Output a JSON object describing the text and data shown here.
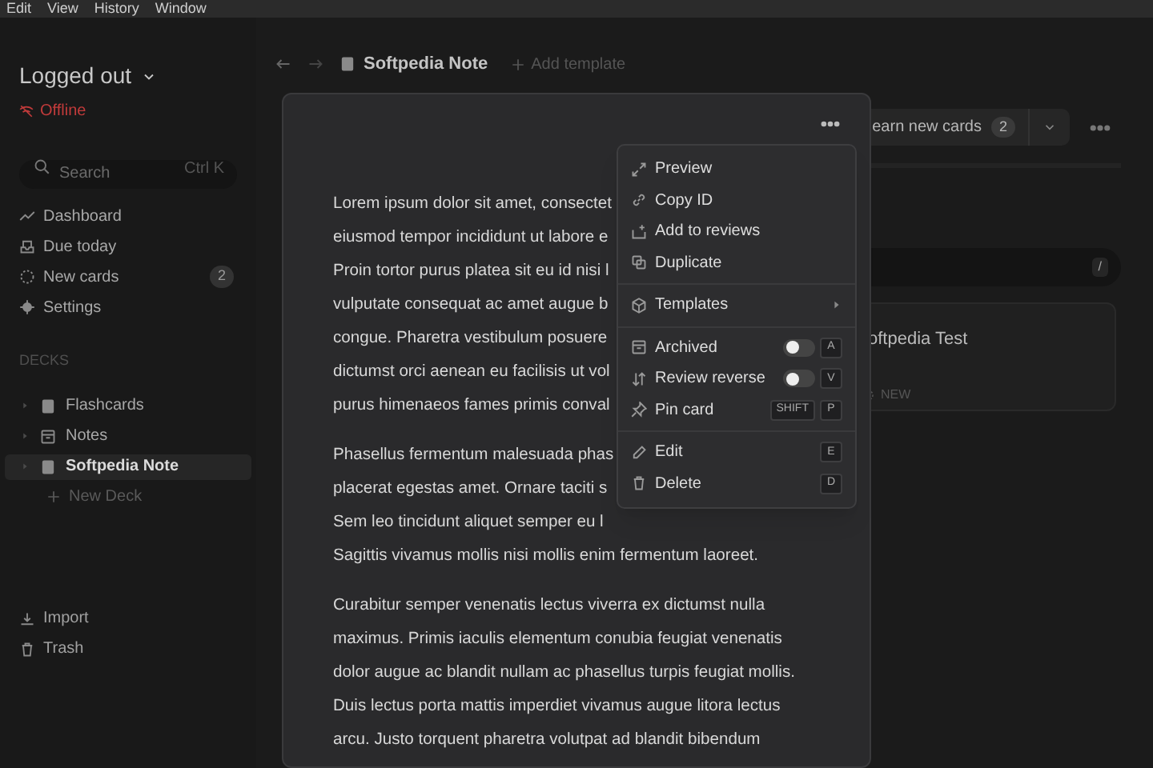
{
  "menu_bar": [
    "Edit",
    "View",
    "History",
    "Window"
  ],
  "sidebar": {
    "account": "Logged out",
    "status": "Offline",
    "search": {
      "placeholder": "Search",
      "shortcut": "Ctrl K"
    },
    "nav": [
      {
        "kind": "dashboard",
        "label": "Dashboard"
      },
      {
        "kind": "due",
        "label": "Due today"
      },
      {
        "kind": "new",
        "label": "New cards",
        "count": "2"
      },
      {
        "kind": "settings",
        "label": "Settings"
      }
    ],
    "decks_heading": "DECKS",
    "decks": [
      {
        "kind": "book",
        "label": "Flashcards",
        "selected": false
      },
      {
        "kind": "archive",
        "label": "Notes",
        "selected": false
      },
      {
        "kind": "book",
        "label": "Softpedia Note",
        "selected": true
      }
    ],
    "new_deck": "New Deck",
    "footer": [
      {
        "kind": "import",
        "label": "Import"
      },
      {
        "kind": "trash",
        "label": "Trash"
      }
    ]
  },
  "header": {
    "title": "Softpedia Note",
    "add_template": "Add template"
  },
  "learn_button": {
    "label": "earn new cards",
    "count": "2"
  },
  "search_key": "/",
  "card": {
    "title": "oftpedia Test",
    "tag": "NEW"
  },
  "note": {
    "paragraphs": [
      [
        "Lorem ipsum dolor sit amet, consectet",
        "eiusmod tempor incididunt ut labore e",
        "Proin tortor purus platea sit eu id nisi l",
        "vulputate consequat ac amet augue b",
        "congue. Pharetra vestibulum posuere",
        "dictumst orci aenean eu facilisis ut vol",
        "purus himenaeos fames primis conval"
      ],
      [
        "Phasellus fermentum malesuada phas",
        "placerat egestas amet. Ornare taciti s",
        "Sem leo tincidunt aliquet semper eu l",
        "Sagittis vivamus mollis nisi mollis enim fermentum laoreet."
      ],
      [
        "Curabitur semper venenatis lectus viverra ex dictumst nulla",
        "maximus. Primis iaculis elementum conubia feugiat venenatis",
        "dolor augue ac blandit nullam ac phasellus turpis feugiat mollis.",
        "Duis lectus porta mattis imperdiet vivamus augue litora lectus",
        "arcu. Justo torquent pharetra volutpat ad blandit bibendum"
      ]
    ]
  },
  "context_menu": {
    "groups": [
      [
        {
          "kind": "preview",
          "label": "Preview"
        },
        {
          "kind": "link",
          "label": "Copy ID"
        },
        {
          "kind": "add",
          "label": "Add to reviews"
        },
        {
          "kind": "copy",
          "label": "Duplicate"
        }
      ],
      [
        {
          "kind": "cube",
          "label": "Templates",
          "submenu": true
        }
      ],
      [
        {
          "kind": "archive",
          "label": "Archived",
          "on": false,
          "keys": [
            "A"
          ]
        },
        {
          "kind": "sort",
          "label": "Review reverse",
          "on": false,
          "keys": [
            "V"
          ]
        },
        {
          "kind": "pin",
          "label": "Pin card",
          "keys": [
            "SHIFT",
            "P"
          ]
        }
      ],
      [
        {
          "kind": "pencil",
          "label": "Edit",
          "keys": [
            "E"
          ]
        },
        {
          "kind": "trash",
          "label": "Delete",
          "keys": [
            "D"
          ]
        }
      ]
    ]
  }
}
